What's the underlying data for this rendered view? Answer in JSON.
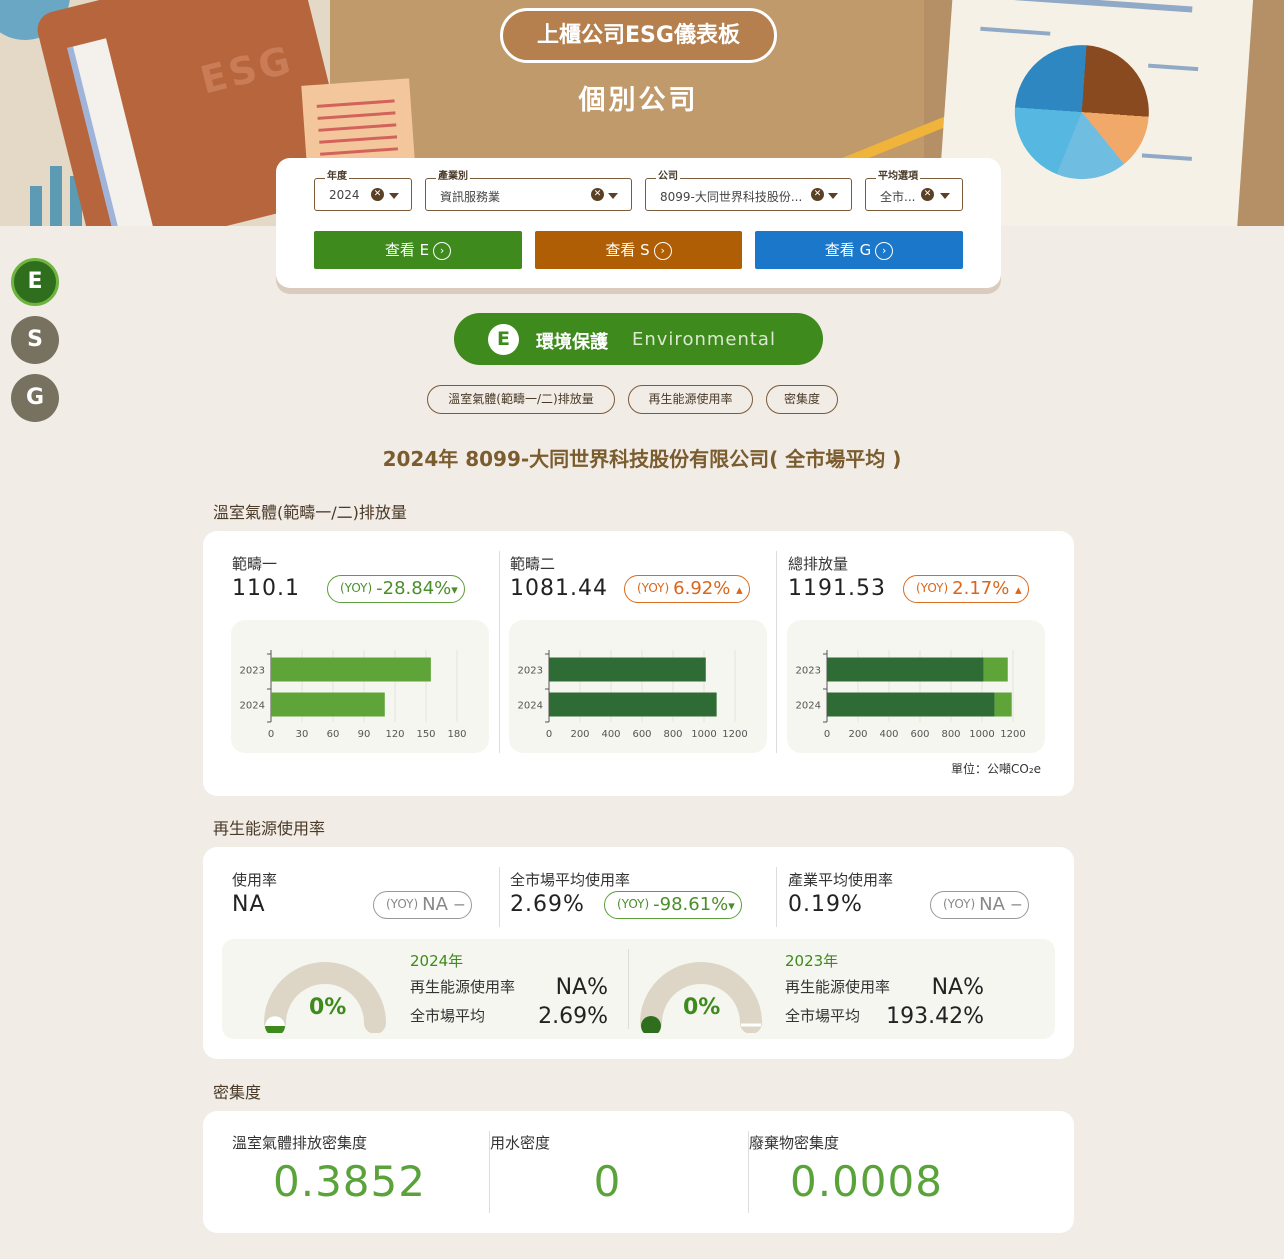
{
  "header": {
    "title": "上櫃公司ESG儀表板",
    "subtitle": "個別公司",
    "decor_label": "ESG"
  },
  "filters": {
    "year": {
      "label": "年度",
      "value": "2024"
    },
    "industry": {
      "label": "產業別",
      "value": "資訊服務業"
    },
    "company": {
      "label": "公司",
      "value": "8099-大同世界科技股份..."
    },
    "average": {
      "label": "平均選項",
      "value": "全市..."
    }
  },
  "buttons": {
    "view_e": "查看 E",
    "view_s": "查看 S",
    "view_g": "查看 G"
  },
  "side_nav": [
    "E",
    "S",
    "G"
  ],
  "section_pill": {
    "letter": "E",
    "zh": "環境保護",
    "en": "Environmental"
  },
  "chips": [
    "溫室氣體(範疇一/二)排放量",
    "再生能源使用率",
    "密集度"
  ],
  "main_title": "2024年 8099-大同世界科技股份有限公司( 全市場平均 )",
  "ghg": {
    "section_title": "溫室氣體(範疇一/二)排放量",
    "unit": "單位：公噸CO₂e",
    "metrics": [
      {
        "label": "範疇一",
        "value": "110.1",
        "yoy_tag": "(YOY)",
        "yoy": "-28.84%",
        "dir": "▾"
      },
      {
        "label": "範疇二",
        "value": "1081.44",
        "yoy_tag": "(YOY)",
        "yoy": "6.92%",
        "dir": "▴"
      },
      {
        "label": "總排放量",
        "value": "1191.53",
        "yoy_tag": "(YOY)",
        "yoy": "2.17%",
        "dir": "▴"
      }
    ]
  },
  "renew": {
    "section_title": "再生能源使用率",
    "metrics": [
      {
        "label": "使用率",
        "value": "NA",
        "yoy_tag": "(YOY)",
        "yoy": "NA",
        "dir": "‒"
      },
      {
        "label": "全市場平均使用率",
        "value": "2.69%",
        "yoy_tag": "(YOY)",
        "yoy": "-98.61%",
        "dir": "▾"
      },
      {
        "label": "產業平均使用率",
        "value": "0.19%",
        "yoy_tag": "(YOY)",
        "yoy": "NA",
        "dir": "‒"
      }
    ],
    "gauges": [
      {
        "percent_text": "0%",
        "percent": 0,
        "year": "2024年",
        "rate_label": "再生能源使用率",
        "rate_value": "NA%",
        "avg_label": "全市場平均",
        "avg_value": "2.69%"
      },
      {
        "percent_text": "0%",
        "percent": 0,
        "year": "2023年",
        "rate_label": "再生能源使用率",
        "rate_value": "NA%",
        "avg_label": "全市場平均",
        "avg_value": "193.42%"
      }
    ]
  },
  "density": {
    "section_title": "密集度",
    "items": [
      {
        "label": "溫室氣體排放密集度",
        "value": "0.3852"
      },
      {
        "label": "用水密度",
        "value": "0"
      },
      {
        "label": "廢棄物密集度",
        "value": "0.0008"
      }
    ]
  },
  "chart_data": [
    {
      "type": "bar",
      "orientation": "horizontal",
      "categories": [
        "2023",
        "2024"
      ],
      "series": [
        {
          "values": [
            154.7,
            110.1
          ]
        }
      ],
      "xlim": [
        0,
        180
      ],
      "xticks": [
        0,
        30,
        60,
        90,
        120,
        150,
        180
      ],
      "colors": [
        "#5fa438"
      ]
    },
    {
      "type": "bar",
      "orientation": "horizontal",
      "categories": [
        "2023",
        "2024"
      ],
      "series": [
        {
          "values": [
            1011.4,
            1081.44
          ]
        }
      ],
      "xlim": [
        0,
        1200
      ],
      "xticks": [
        0,
        200,
        400,
        600,
        800,
        1000,
        1200
      ],
      "colors": [
        "#2f6b35"
      ]
    },
    {
      "type": "bar",
      "orientation": "horizontal",
      "stacked": true,
      "categories": [
        "2023",
        "2024"
      ],
      "series": [
        {
          "values": [
            1011.4,
            1081.44
          ]
        },
        {
          "values": [
            154.7,
            110.1
          ]
        }
      ],
      "xlim": [
        0,
        1200
      ],
      "xticks": [
        0,
        200,
        400,
        600,
        800,
        1000,
        1200
      ],
      "colors": [
        "#2f6b35",
        "#5fa438"
      ]
    }
  ]
}
